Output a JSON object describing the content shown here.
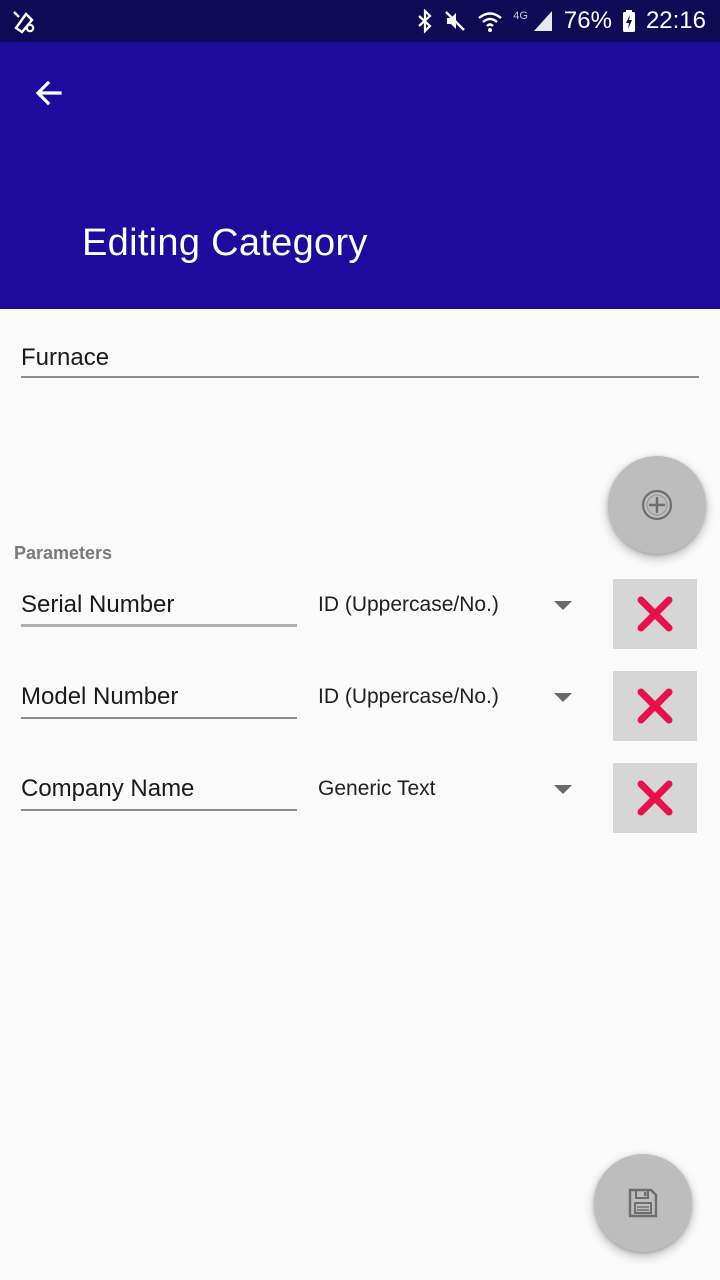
{
  "status_bar": {
    "battery_percent": "76%",
    "time": "22:16",
    "network": "4G",
    "icons": [
      "notification-icon",
      "bluetooth-icon",
      "mute-icon",
      "wifi-icon",
      "signal-icon",
      "battery-icon"
    ]
  },
  "app_bar": {
    "title": "Editing Category",
    "back_icon": "arrow-back-icon",
    "color": "#1e0b9d"
  },
  "category": {
    "name": "Furnace"
  },
  "add_button": {
    "icon": "add-circle-icon"
  },
  "parameters": {
    "label": "Parameters",
    "items": [
      {
        "name": "Serial Number",
        "type": "ID (Uppercase/No.)"
      },
      {
        "name": "Model Number",
        "type": "ID (Uppercase/No.)"
      },
      {
        "name": "Company Name",
        "type": "Generic Text"
      }
    ],
    "delete_icon": "close-icon",
    "delete_color": "#e8114e"
  },
  "save_button": {
    "icon": "save-icon"
  }
}
